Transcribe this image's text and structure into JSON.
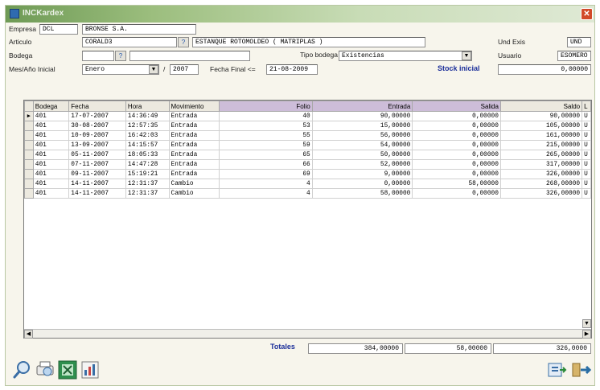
{
  "window": {
    "title": "INCKardex",
    "close_icon": "close-icon"
  },
  "form": {
    "empresa_label": "Empresa",
    "empresa_code": "DCL",
    "empresa_name": "BRONSE S.A.",
    "articulo_label": "Articulo",
    "articulo_code": "CORALD3",
    "articulo_desc": "ESTANQUE ROTOMOLDEO ( MATRIPLAS )",
    "und_exis_label": "Und Exis",
    "und_exis_value": "UND",
    "bodega_label": "Bodega",
    "bodega_value": "",
    "tipo_bodega_label": "Tipo bodega",
    "tipo_bodega_value": "Existencias",
    "usuario_label": "Usuario",
    "usuario_value": "ESOMERO",
    "mes_label": "Mes/Año Inicial",
    "mes_value": "Enero",
    "slash": "/",
    "anio_value": "2007",
    "fecha_final_label": "Fecha Final <=",
    "fecha_final_value": "21-08-2009",
    "stock_label": "Stock inicial",
    "stock_value": "0,00000"
  },
  "grid": {
    "columns": [
      "Bodega",
      "Fecha",
      "Hora",
      "Movimiento",
      "Folio",
      "Entrada",
      "Salida",
      "Saldo",
      "L"
    ],
    "rows": [
      {
        "bodega": "401",
        "fecha": "17-07-2007",
        "hora": "14:36:49",
        "mov": "Entrada",
        "folio": "40",
        "entrada": "90,00000",
        "salida": "0,00000",
        "saldo": "90,00000",
        "l": "U",
        "current": true
      },
      {
        "bodega": "401",
        "fecha": "30-08-2007",
        "hora": "12:57:35",
        "mov": "Entrada",
        "folio": "53",
        "entrada": "15,00000",
        "salida": "0,00000",
        "saldo": "105,00000",
        "l": "U"
      },
      {
        "bodega": "401",
        "fecha": "10-09-2007",
        "hora": "16:42:03",
        "mov": "Entrada",
        "folio": "55",
        "entrada": "56,00000",
        "salida": "0,00000",
        "saldo": "161,00000",
        "l": "U"
      },
      {
        "bodega": "401",
        "fecha": "13-09-2007",
        "hora": "14:15:57",
        "mov": "Entrada",
        "folio": "59",
        "entrada": "54,00000",
        "salida": "0,00000",
        "saldo": "215,00000",
        "l": "U"
      },
      {
        "bodega": "401",
        "fecha": "05-11-2007",
        "hora": "18:05:33",
        "mov": "Entrada",
        "folio": "65",
        "entrada": "50,00000",
        "salida": "0,00000",
        "saldo": "265,00000",
        "l": "U"
      },
      {
        "bodega": "401",
        "fecha": "07-11-2007",
        "hora": "14:47:28",
        "mov": "Entrada",
        "folio": "66",
        "entrada": "52,00000",
        "salida": "0,00000",
        "saldo": "317,00000",
        "l": "U"
      },
      {
        "bodega": "401",
        "fecha": "09-11-2007",
        "hora": "15:19:21",
        "mov": "Entrada",
        "folio": "69",
        "entrada": "9,00000",
        "salida": "0,00000",
        "saldo": "326,00000",
        "l": "U"
      },
      {
        "bodega": "401",
        "fecha": "14-11-2007",
        "hora": "12:31:37",
        "mov": "Cambio",
        "folio": "4",
        "entrada": "0,00000",
        "salida": "58,00000",
        "saldo": "268,00000",
        "l": "U"
      },
      {
        "bodega": "401",
        "fecha": "14-11-2007",
        "hora": "12:31:37",
        "mov": "Cambio",
        "folio": "4",
        "entrada": "58,00000",
        "salida": "0,00000",
        "saldo": "326,00000",
        "l": "U"
      }
    ]
  },
  "totals": {
    "label": "Totales",
    "entrada": "384,00000",
    "salida": "58,00000",
    "saldo": "326,0000"
  },
  "toolbar": {
    "icons": [
      "search-icon",
      "print-preview-icon",
      "excel-export-icon",
      "chart-icon"
    ],
    "right_icons": [
      "export-icon",
      "exit-icon"
    ]
  }
}
